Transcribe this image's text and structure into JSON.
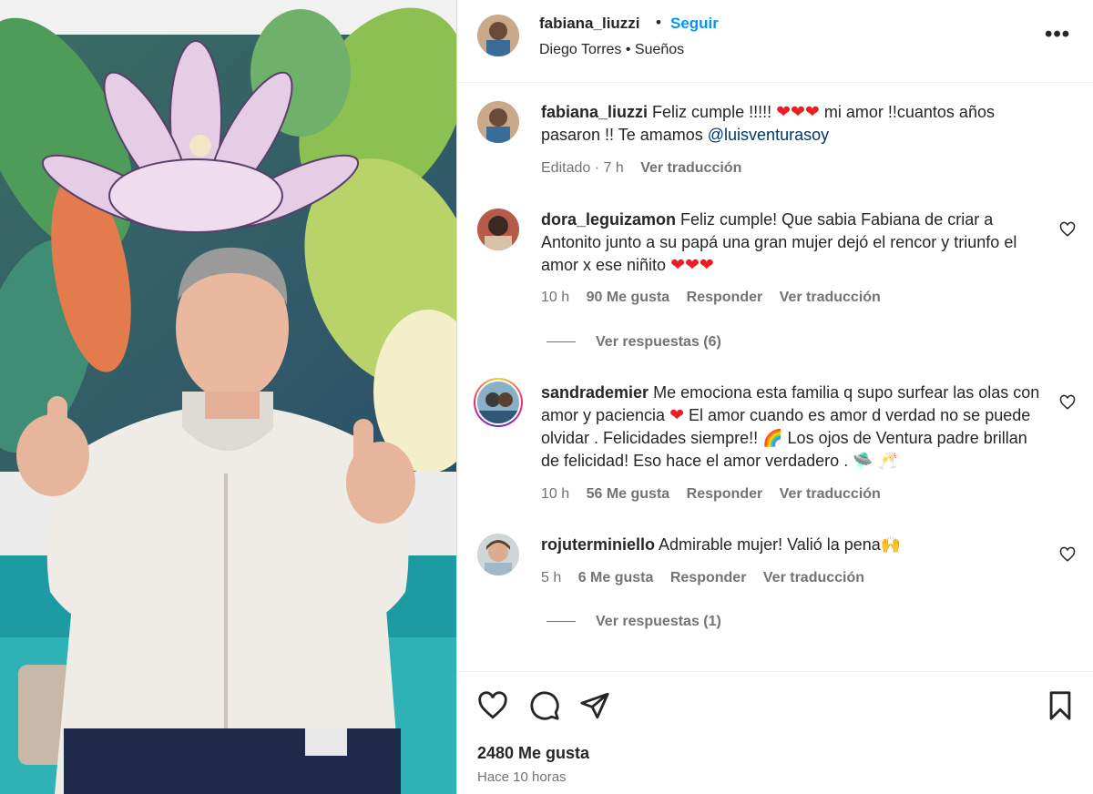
{
  "post": {
    "username": "fabiana_liuzzi",
    "separator": "•",
    "follow_label": "Seguir",
    "music": "Diego Torres • Sueños",
    "more_label": "•••"
  },
  "caption": {
    "username": "fabiana_liuzzi",
    "text_1": "Feliz cumple !!!!! ",
    "hearts": "❤❤❤",
    "text_2": "mi amor !!cuantos años pasaron !! Te amamos ",
    "mention": "@luisventurasoy",
    "meta_edited": "Editado · 7 h",
    "meta_translate": "Ver traducción"
  },
  "comments": [
    {
      "username": "dora_leguizamon",
      "text": "Feliz cumple! Que sabia Fabiana de criar a Antonito junto a su papá una gran mujer dejó el rencor y triunfo el amor x ese niñito ",
      "emoji": "❤❤❤",
      "time": "10 h",
      "likes": "90 Me gusta",
      "reply": "Responder",
      "translate": "Ver traducción",
      "replies": "Ver respuestas (6)"
    },
    {
      "username": "sandrademier",
      "text_1": "Me emociona esta familia q supo surfear las olas con amor y paciencia ",
      "heart": "❤",
      "text_2": " El amor cuando es amor d verdad no se puede olvidar . Felicidades siempre!! ",
      "rainbow": "🌈",
      "text_3": " Los ojos de Ventura padre brillan de felicidad! Eso hace el amor verdadero . ",
      "emoji_end": "🛸 🥂",
      "time": "10 h",
      "likes": "56 Me gusta",
      "reply": "Responder",
      "translate": "Ver traducción"
    },
    {
      "username": "rojuterminiello",
      "text": "Admirable mujer! Valió la pena",
      "emoji": "🙌",
      "time": "5 h",
      "likes": "6 Me gusta",
      "reply": "Responder",
      "translate": "Ver traducción",
      "replies": "Ver respuestas (1)"
    }
  ],
  "footer": {
    "likes": "2480 Me gusta",
    "time": "Hace 10 horas"
  },
  "icons": {
    "like": "heart-outline-icon",
    "comment": "comment-bubble-icon",
    "share": "paper-plane-icon",
    "save": "bookmark-icon"
  },
  "colors": {
    "link_blue": "#0095f6",
    "mention": "#00376b",
    "muted": "#737373",
    "text": "#262626"
  }
}
